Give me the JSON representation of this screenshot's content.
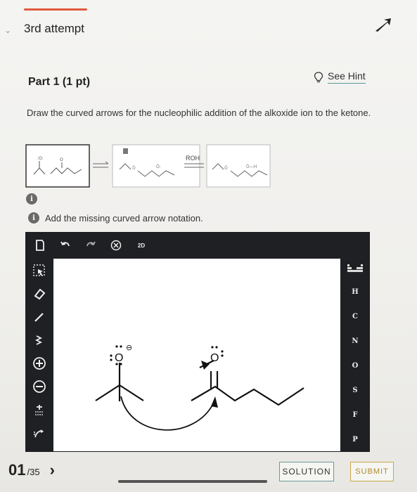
{
  "header": {
    "attempt_label": "3rd attempt",
    "nav_icon": "arrow-up-right-icon",
    "accent_color": "#e05a3e"
  },
  "part": {
    "title": "Part 1 (1 pt)",
    "hint_label": "See Hint",
    "hint_icon": "lightbulb-icon"
  },
  "question": {
    "text": "Draw the curved arrows for the nucleophilic addition of the alkoxide ion to the ketone."
  },
  "scheme": {
    "reagent": "ROH",
    "info_badge": "i"
  },
  "instruction": {
    "text": "Add the missing curved arrow notation."
  },
  "editor": {
    "top_tools": [
      "new-doc-icon",
      "undo-icon",
      "redo-icon",
      "clear-icon",
      "zoom-2d-icon"
    ],
    "zoom_label": "2D",
    "left_tools": [
      "select-icon",
      "eraser-icon",
      "bond-icon",
      "chain-icon",
      "plus-charge-icon",
      "minus-charge-icon",
      "electron-pairs-icon",
      "curved-arrow-icon"
    ],
    "elements": [
      "H",
      "C",
      "N",
      "O",
      "S",
      "F",
      "P"
    ],
    "canvas_labels": {
      "alkoxide_o": "O",
      "alkoxide_charge": "⊖",
      "ketone_o": "O"
    }
  },
  "footer": {
    "counter": "01",
    "counter_total": "/35",
    "solution_label": "SOLUTION",
    "submit_label": "SUBMIT",
    "submit_color": "#b48a2a"
  }
}
